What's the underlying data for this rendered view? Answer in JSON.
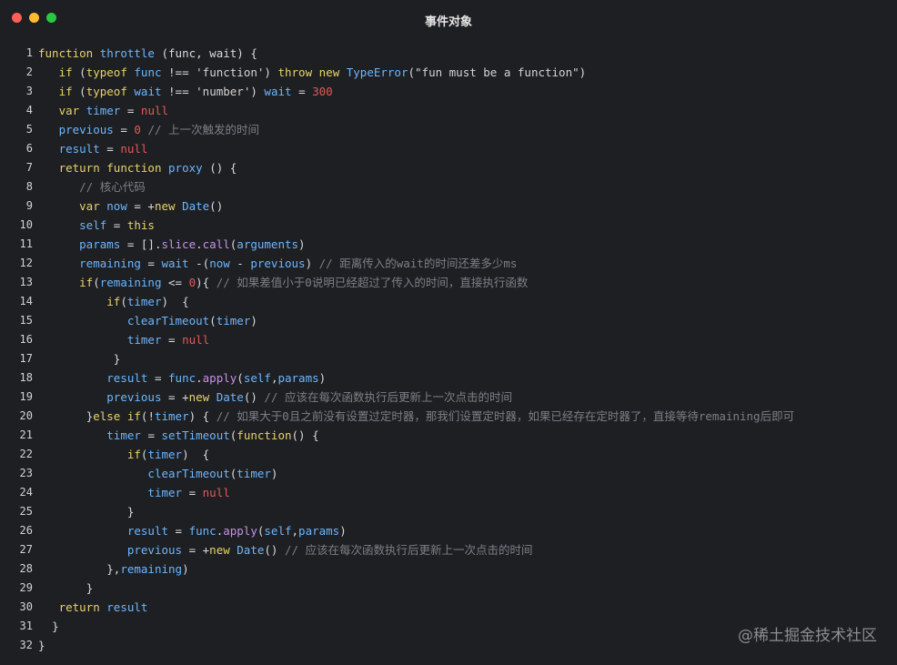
{
  "window": {
    "title": "事件对象"
  },
  "code": {
    "lines": [
      {
        "n": "1",
        "html": "<span class='kw'>function</span> <span class='fn'>throttle</span> <span class='pl'>(func, wait) {</span>"
      },
      {
        "n": "2",
        "html": "   <span class='kw'>if</span> <span class='pl'>(</span><span class='kw'>typeof</span> <span class='var'>func</span> <span class='pl'>!==</span> <span class='st'>'function'</span><span class='pl'>)</span> <span class='kw'>throw</span> <span class='kw'>new</span> <span class='cls'>TypeError</span><span class='pl'>(</span><span class='st'>\"fun must be a function\"</span><span class='pl'>)</span>"
      },
      {
        "n": "3",
        "html": "   <span class='kw'>if</span> <span class='pl'>(</span><span class='kw'>typeof</span> <span class='var'>wait</span> <span class='pl'>!==</span> <span class='st'>'number'</span><span class='pl'>)</span> <span class='var'>wait</span> <span class='pl'>=</span> <span class='nm'>300</span>"
      },
      {
        "n": "4",
        "html": "   <span class='kw'>var</span> <span class='var'>timer</span> <span class='pl'>=</span> <span class='nm'>null</span>"
      },
      {
        "n": "5",
        "html": "   <span class='var'>previous</span> <span class='pl'>=</span> <span class='nm'>0</span> <span class='cm'>// 上一次触发的时间</span>"
      },
      {
        "n": "6",
        "html": "   <span class='var'>result</span> <span class='pl'>=</span> <span class='nm'>null</span>"
      },
      {
        "n": "7",
        "html": "   <span class='kw'>return</span> <span class='kw'>function</span> <span class='fn'>proxy</span> <span class='pl'>() {</span>"
      },
      {
        "n": "8",
        "html": "      <span class='cm'>// 核心代码</span>"
      },
      {
        "n": "9",
        "html": "      <span class='kw'>var</span> <span class='var'>now</span> <span class='pl'>= +</span><span class='kw'>new</span> <span class='cls'>Date</span><span class='pl'>()</span>"
      },
      {
        "n": "10",
        "html": "      <span class='var'>self</span> <span class='pl'>=</span> <span class='kw'>this</span>"
      },
      {
        "n": "11",
        "html": "      <span class='var'>params</span> <span class='pl'>= [].</span><span class='prop'>slice</span><span class='pl'>.</span><span class='prop'>call</span><span class='pl'>(</span><span class='var'>arguments</span><span class='pl'>)</span>"
      },
      {
        "n": "12",
        "html": "      <span class='var'>remaining</span> <span class='pl'>=</span> <span class='var'>wait</span> <span class='pl'>-(</span><span class='var'>now</span> <span class='pl'>-</span> <span class='var'>previous</span><span class='pl'>)</span> <span class='cm'>// 距离传入的wait的时间还差多少ms</span>"
      },
      {
        "n": "13",
        "html": "      <span class='kw'>if</span><span class='pl'>(</span><span class='var'>remaining</span> <span class='pl'>&lt;=</span> <span class='nm'>0</span><span class='pl'>){</span> <span class='cm'>// 如果差值小于0说明已经超过了传入的时间，直接执行函数</span>"
      },
      {
        "n": "14",
        "html": "          <span class='kw'>if</span><span class='pl'>(</span><span class='var'>timer</span><span class='pl'>)  {</span>"
      },
      {
        "n": "15",
        "html": "             <span class='fn'>clearTimeout</span><span class='pl'>(</span><span class='var'>timer</span><span class='pl'>)</span>"
      },
      {
        "n": "16",
        "html": "             <span class='var'>timer</span> <span class='pl'>=</span> <span class='nm'>null</span>"
      },
      {
        "n": "17",
        "html": "           <span class='pl'>}</span>"
      },
      {
        "n": "18",
        "html": "          <span class='var'>result</span> <span class='pl'>=</span> <span class='var'>func</span><span class='pl'>.</span><span class='prop'>apply</span><span class='pl'>(</span><span class='var'>self</span><span class='pl'>,</span><span class='var'>params</span><span class='pl'>)</span>"
      },
      {
        "n": "19",
        "html": "          <span class='var'>previous</span> <span class='pl'>= +</span><span class='kw'>new</span> <span class='cls'>Date</span><span class='pl'>()</span> <span class='cm'>// 应该在每次函数执行后更新上一次点击的时间</span>"
      },
      {
        "n": "20",
        "html": "       <span class='pl'>}</span><span class='kw'>else</span> <span class='kw'>if</span><span class='pl'>(!</span><span class='var'>timer</span><span class='pl'>) {</span> <span class='cm'>// 如果大于0且之前没有设置过定时器，那我们设置定时器，如果已经存在定时器了，直接等待remaining后即可</span>"
      },
      {
        "n": "21",
        "html": "          <span class='var'>timer</span> <span class='pl'>=</span> <span class='fn'>setTimeout</span><span class='pl'>(</span><span class='kw'>function</span><span class='pl'>() {</span>"
      },
      {
        "n": "22",
        "html": "             <span class='kw'>if</span><span class='pl'>(</span><span class='var'>timer</span><span class='pl'>)  {</span>"
      },
      {
        "n": "23",
        "html": "                <span class='fn'>clearTimeout</span><span class='pl'>(</span><span class='var'>timer</span><span class='pl'>)</span>"
      },
      {
        "n": "24",
        "html": "                <span class='var'>timer</span> <span class='pl'>=</span> <span class='nm'>null</span>"
      },
      {
        "n": "25",
        "html": "             <span class='pl'>}</span>"
      },
      {
        "n": "26",
        "html": "             <span class='var'>result</span> <span class='pl'>=</span> <span class='var'>func</span><span class='pl'>.</span><span class='prop'>apply</span><span class='pl'>(</span><span class='var'>self</span><span class='pl'>,</span><span class='var'>params</span><span class='pl'>)</span>"
      },
      {
        "n": "27",
        "html": "             <span class='var'>previous</span> <span class='pl'>= +</span><span class='kw'>new</span> <span class='cls'>Date</span><span class='pl'>()</span> <span class='cm'>// 应该在每次函数执行后更新上一次点击的时间</span>"
      },
      {
        "n": "28",
        "html": "          <span class='pl'>},</span><span class='var'>remaining</span><span class='pl'>)</span>"
      },
      {
        "n": "29",
        "html": "       <span class='pl'>}</span>"
      },
      {
        "n": "30",
        "html": "   <span class='kw'>return</span> <span class='var'>result</span>"
      },
      {
        "n": "31",
        "html": "  <span class='pl'>}</span>"
      },
      {
        "n": "32",
        "html": "<span class='pl'>}</span>"
      }
    ]
  },
  "watermark": {
    "text": "@稀土掘金技术社区"
  },
  "colors": {
    "background": "#1e1f22",
    "keyword": "#e8d36a",
    "function": "#6cb6ff",
    "number": "#e05a5a",
    "comment": "#7b7f87"
  }
}
